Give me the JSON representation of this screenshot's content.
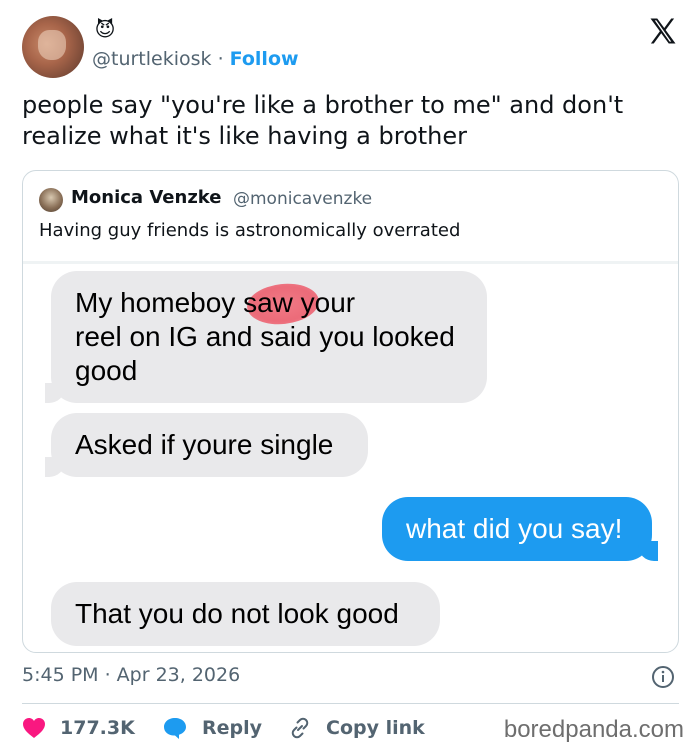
{
  "author": {
    "emoji": "😈",
    "handle": "@turtlekiosk",
    "separator": " · ",
    "follow_label": "Follow"
  },
  "tweet": {
    "text": "people say \"you're like a brother to me\" and don't realize what it's like having a brother"
  },
  "quoted": {
    "name": "Monica Venzke",
    "handle": "@monicavenzke",
    "text": "Having guy friends is astronomically overrated",
    "messages": [
      {
        "side": "received",
        "lines": [
          "My homeboy        saw your",
          "reel on IG and said you looked",
          "good"
        ]
      },
      {
        "side": "received",
        "text": "Asked if youre single"
      },
      {
        "side": "sent",
        "text": "what did you say!"
      },
      {
        "side": "received",
        "text": "That you do not look good"
      }
    ]
  },
  "meta": {
    "timestamp": "5:45 PM · Apr 23, 2026"
  },
  "actions": {
    "likes": "177.3K",
    "reply_label": "Reply",
    "copy_label": "Copy link"
  },
  "watermark": "boredpanda.com",
  "colors": {
    "accent": "#1d9bf0",
    "like": "#f91880",
    "bubble_received": "#e9e9eb",
    "bubble_sent": "#1d9bf0"
  }
}
